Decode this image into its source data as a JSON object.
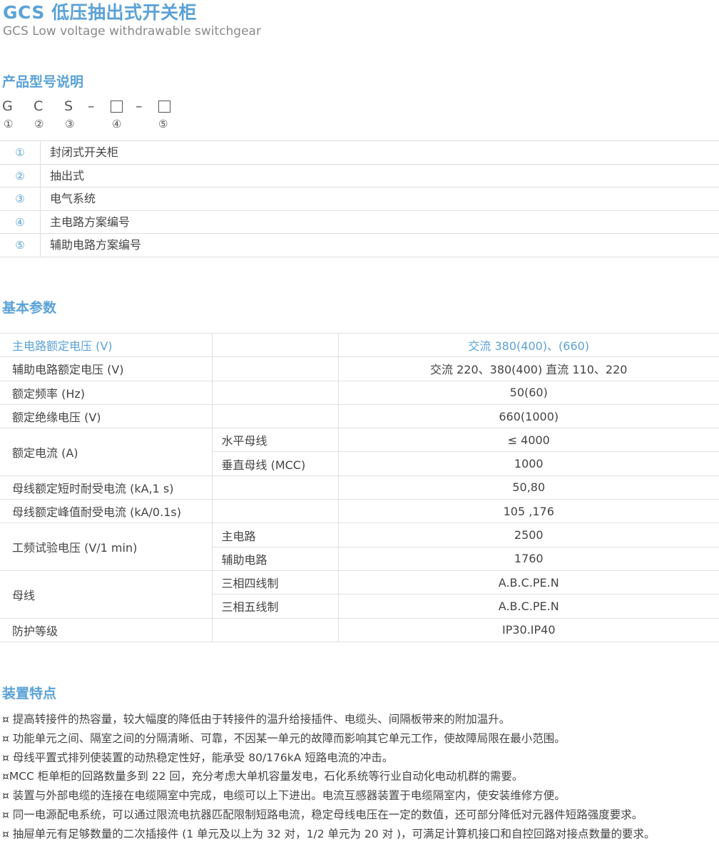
{
  "header": {
    "title": "GCS 低压抽出式开关柜",
    "subtitle": "GCS Low voltage withdrawable switchgear"
  },
  "model": {
    "section_title": "产品型号说明",
    "code": {
      "c1": "G",
      "c2": "C",
      "c3": "S",
      "dash1": "–",
      "dash2": "–"
    },
    "numbers": [
      "①",
      "②",
      "③",
      "④",
      "⑤"
    ],
    "legend": [
      {
        "num": "①",
        "text": "封闭式开关柜"
      },
      {
        "num": "②",
        "text": "抽出式"
      },
      {
        "num": "③",
        "text": "电气系统"
      },
      {
        "num": "④",
        "text": "主电路方案编号"
      },
      {
        "num": "⑤",
        "text": "辅助电路方案编号"
      }
    ]
  },
  "params": {
    "section_title": "基本参数",
    "rows": {
      "main_voltage": {
        "label": "主电路额定电压 (V)",
        "value": "交流 380(400)、(660)"
      },
      "aux_voltage": {
        "label": "辅助电路额定电压 (V)",
        "value": "交流 220、380(400)  直流 110、220"
      },
      "frequency": {
        "label": "额定频率 (Hz)",
        "value": "50(60)"
      },
      "insulation": {
        "label": "额定绝缘电压 (V)",
        "value": "660(1000)"
      },
      "current": {
        "label": "额定电流 (A)",
        "sub1": "水平母线",
        "val1": "≤ 4000",
        "sub2": "垂直母线 (MCC)",
        "val2": "1000"
      },
      "short_time": {
        "label": "母线额定短时耐受电流 (kA,1 s)",
        "value": "50,80"
      },
      "peak": {
        "label": "母线额定峰值耐受电流 (kA/0.1s)",
        "value": "105 ,176"
      },
      "test_voltage": {
        "label": "工频试验电压 (V/1 min)",
        "sub1": "主电路",
        "val1": "2500",
        "sub2": "辅助电路",
        "val2": "1760"
      },
      "busbar": {
        "label": "母线",
        "sub1": "三相四线制",
        "val1": "A.B.C.PE.N",
        "sub2": "三相五线制",
        "val2": "A.B.C.PE.N"
      },
      "protection": {
        "label": "防护等级",
        "value": "IP30.IP40"
      }
    }
  },
  "features": {
    "section_title": "装置特点",
    "items": [
      "¤ 提高转接件的热容量，较大幅度的降低由于转接件的温升给接插件、电缆头、间隔板带来的附加温升。",
      "¤ 功能单元之间、隔室之间的分隔清晰、可靠，不因某一单元的故障而影响其它单元工作，使故障局限在最小范围。",
      "¤ 母线平置式排列使装置的动热稳定性好，能承受 80/176kA 短路电流的冲击。",
      "¤MCC 柜单柜的回路数量多到 22 回，充分考虑大单机容量发电，石化系统等行业自动化电动机群的需要。",
      "¤ 装置与外部电缆的连接在电缆隔室中完成，电缆可以上下进出。电流互感器装置于电缆隔室内，使安装维修方便。",
      "¤ 同一电源配电系统，可以通过限流电抗器匹配限制短路电流，稳定母线电压在一定的数值，还可部分降低对元器件短路强度要求。",
      "¤ 抽屉单元有足够数量的二次插接件 (1 单元及以上为 32 对，1/2 单元为 20 对 )，可满足计算机接口和自控回路对接点数量的要求。"
    ]
  },
  "colors": {
    "accent": "#5ba2d6",
    "text": "#444444",
    "muted": "#8a8a8a",
    "rule": "#dedede"
  }
}
